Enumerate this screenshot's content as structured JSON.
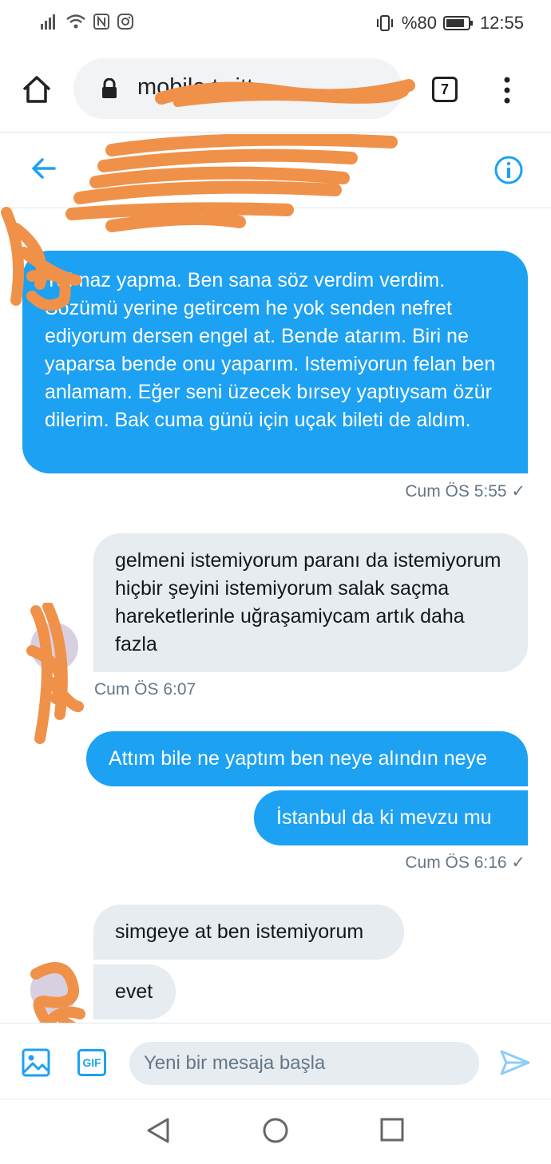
{
  "status_bar": {
    "battery_text": "%80",
    "time": "12:55"
  },
  "browser": {
    "url_text": "mobile.twitt",
    "tab_count": "7"
  },
  "conversation": {
    "messages": [
      {
        "direction": "outgoing",
        "text": "Ya! naz yapma. Ben sana söz verdim verdim. Sözümü yerine getircem he yok senden nefret ediyorum dersen engel at. Bende atarım. Biri ne yaparsa bende onu yaparım. Istemiyorun felan ben anlamam. Eğer seni üzecek bırsey yaptıysam özür dilerim. Bak cuma günü için uçak bileti de aldım."
      },
      {
        "direction": "incoming",
        "text": "gelmeni istemiyorum paranı da istemiyorum hiçbir şeyini istemiyorum salak saçma hareketlerinle uğraşamiycam artık daha fazla"
      },
      {
        "direction": "outgoing",
        "text": "Attım bile ne yaptım ben neye alındın neye"
      },
      {
        "direction": "outgoing",
        "text": "İstanbul da ki mevzu mu"
      },
      {
        "direction": "incoming",
        "text": "simgeye at ben istemiyorum"
      },
      {
        "direction": "incoming",
        "text": "evet"
      }
    ],
    "timestamps": [
      "Cum ÖS 5:55 ✓",
      "Cum ÖS 6:07",
      "Cum ÖS 6:16 ✓"
    ]
  },
  "composer": {
    "placeholder": "Yeni bir mesaja başla",
    "gif_label": "GIF"
  },
  "colors": {
    "accent": "#1da1f2",
    "incoming_bubble": "#e6ecf0",
    "redaction": "#f0914a"
  },
  "icons": [
    "signal-icon",
    "wifi-icon",
    "nfc-icon",
    "instagram-icon",
    "vibrate-icon",
    "battery-icon",
    "home-icon",
    "lock-icon",
    "tabs-icon",
    "menu-icon",
    "back-arrow-icon",
    "info-icon",
    "image-icon",
    "gif-icon",
    "send-icon",
    "nav-back-icon",
    "nav-home-icon",
    "nav-recents-icon"
  ]
}
